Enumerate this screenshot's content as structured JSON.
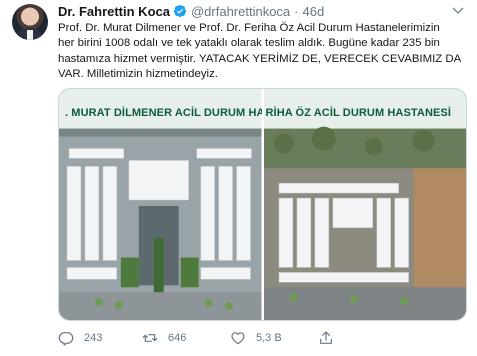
{
  "tweet": {
    "author_name": "Dr. Fahrettin Koca",
    "handle": "@drfahrettinkoca",
    "separator": "·",
    "time": "46d",
    "text_lines": [
      "Prof. Dr. Murat Dilmener ve Prof. Dr. Feriha Öz Acil Durum Hastanelerimizin",
      "her birini 1008 odalı ve tek yataklı olarak teslim aldık. Bugüne kadar 235 bin",
      "hastamıza hizmet vermiştir. YATACAK YERİMİZ DE, VERECEK CEVABIMIZ DA",
      "VAR. Milletimizin hizmetindeyiz."
    ],
    "photos": [
      {
        "banner": ". MURAT DİLMENER ACİL DURUM HAS"
      },
      {
        "banner": "RİHA ÖZ ACİL DURUM HASTANESİ"
      }
    ],
    "actions": {
      "replies": "243",
      "retweets": "646",
      "likes": "5,3 B"
    },
    "colors": {
      "verified": "#1da1f2",
      "muted": "#657786",
      "banner_text": "#0f5c3a"
    }
  }
}
